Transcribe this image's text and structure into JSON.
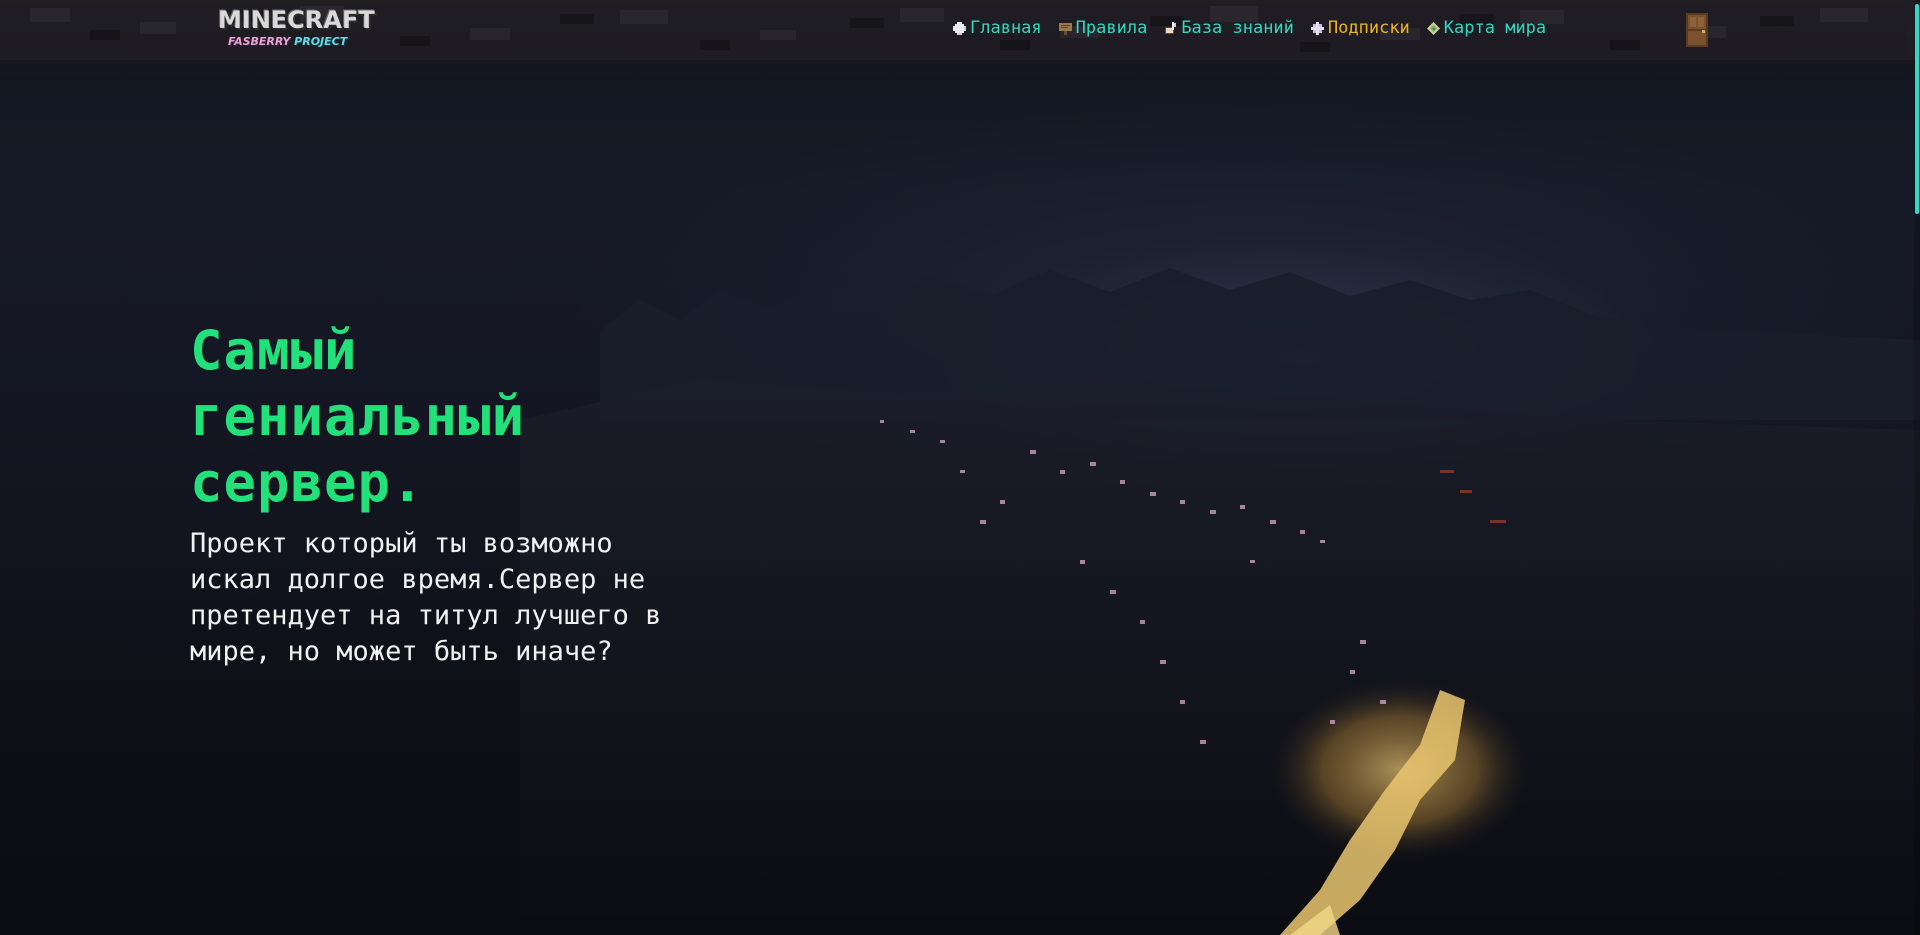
{
  "logo": {
    "main": "MINECRAFT",
    "sub_left": "FASBERRY",
    "sub_right": "PROJECT"
  },
  "nav": {
    "items": [
      {
        "label": "Главная",
        "icon": "snowball-icon",
        "active": false
      },
      {
        "label": "Правила",
        "icon": "sign-icon",
        "active": false
      },
      {
        "label": "База знаний",
        "icon": "book-quill-icon",
        "active": false
      },
      {
        "label": "Подписки",
        "icon": "nether-star-icon",
        "active": true
      },
      {
        "label": "Карта мира",
        "icon": "map-icon",
        "active": false
      }
    ],
    "login_icon": "door-icon"
  },
  "hero": {
    "title": "Самый гениальный сервер.",
    "description": "Проект который ты возможно искал долгое время.Сервер не претендует на титул лучшего в мире, но может быть иначе?"
  },
  "colors": {
    "nav_link": "#33d6c2",
    "nav_active": "#f0b422",
    "title": "#22e07a",
    "text": "#f1f1f1",
    "scrollbar": "#2fd9c8"
  }
}
